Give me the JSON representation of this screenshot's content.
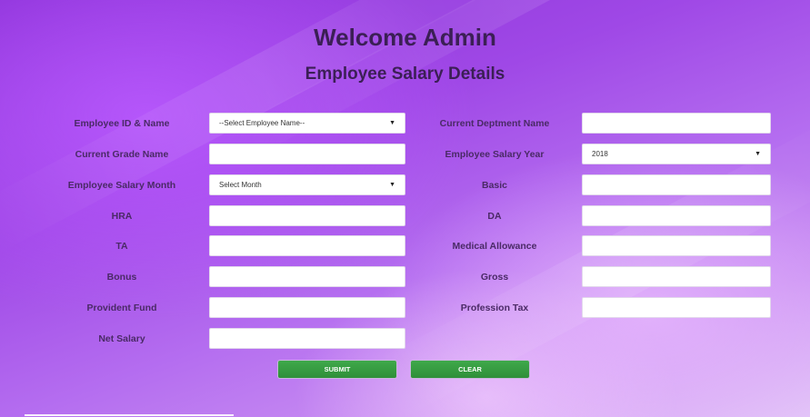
{
  "header": {
    "title": "Welcome Admin",
    "subtitle": "Employee Salary Details"
  },
  "form": {
    "left": [
      {
        "label": "Employee ID & Name",
        "type": "select",
        "value": "--Select Employee Name--"
      },
      {
        "label": "Current Grade Name",
        "type": "input",
        "value": ""
      },
      {
        "label": "Employee Salary Month",
        "type": "select",
        "value": "Select Month"
      },
      {
        "label": "HRA",
        "type": "input",
        "value": ""
      },
      {
        "label": "TA",
        "type": "input",
        "value": ""
      },
      {
        "label": "Bonus",
        "type": "input",
        "value": ""
      },
      {
        "label": "Provident Fund",
        "type": "input",
        "value": ""
      },
      {
        "label": "Net Salary",
        "type": "input",
        "value": ""
      }
    ],
    "right": [
      {
        "label": "Current Deptment Name",
        "type": "input",
        "value": ""
      },
      {
        "label": "Employee Salary Year",
        "type": "select",
        "value": "2018"
      },
      {
        "label": "Basic",
        "type": "input",
        "value": ""
      },
      {
        "label": "DA",
        "type": "input",
        "value": ""
      },
      {
        "label": "Medical Allowance",
        "type": "input",
        "value": ""
      },
      {
        "label": "Gross",
        "type": "input",
        "value": ""
      },
      {
        "label": "Profession Tax",
        "type": "input",
        "value": ""
      }
    ]
  },
  "buttons": {
    "submit": "SUBMIT",
    "clear": "CLEAR"
  },
  "icons": {
    "dropdown": "chevron-down-icon",
    "arrow_glyph": "▼"
  },
  "colors": {
    "heading": "#3b1f55",
    "button": "#2f8f3a",
    "background_start": "#8a2fd6",
    "background_end": "#e2c5f7"
  }
}
